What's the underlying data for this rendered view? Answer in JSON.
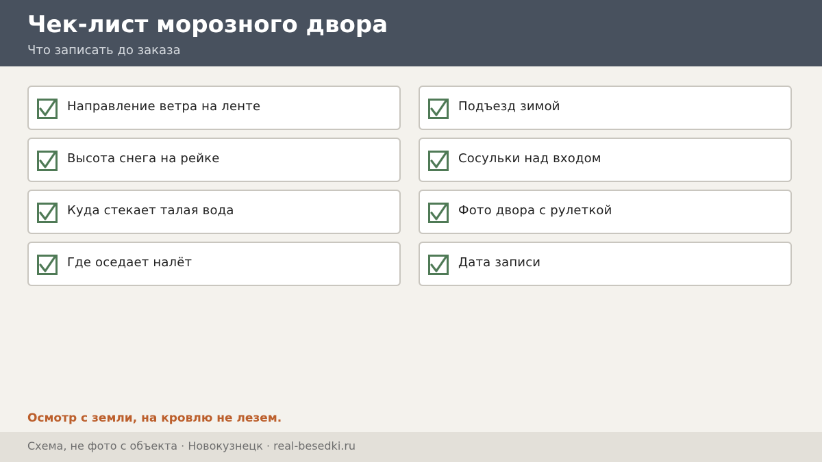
{
  "header": {
    "title": "Чек-лист морозного двора",
    "subtitle": "Что записать до заказа"
  },
  "checklist": {
    "items": [
      {
        "label": "Направление ветра на ленте",
        "checked": true
      },
      {
        "label": "Подъезд зимой",
        "checked": true
      },
      {
        "label": "Высота снега на рейке",
        "checked": true
      },
      {
        "label": "Сосульки над входом",
        "checked": true
      },
      {
        "label": "Куда стекает талая вода",
        "checked": true
      },
      {
        "label": "Фото двора с рулеткой",
        "checked": true
      },
      {
        "label": "Где оседает налёт",
        "checked": true
      },
      {
        "label": "Дата записи",
        "checked": true
      }
    ],
    "check_color": "#4f7a56"
  },
  "note": "Осмотр с земли, на кровлю не лезем.",
  "footer": {
    "text": "Схема, не фото с объекта  ·  Новокузнецк  ·  real-besedki.ru"
  },
  "colors": {
    "header_bg": "#48515e",
    "page_bg": "#f4f2ed",
    "accent": "#bc5f2c",
    "footer_bg": "#e3e0d9"
  }
}
